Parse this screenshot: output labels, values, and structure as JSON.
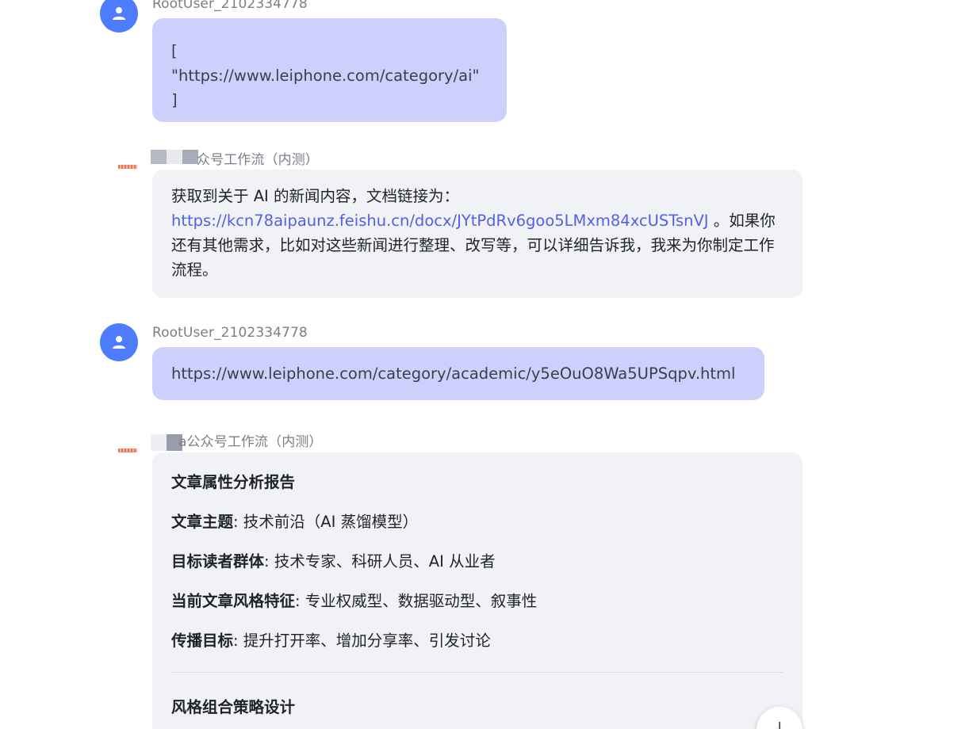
{
  "messages": [
    {
      "role": "user",
      "sender": "RootUser_2102334778",
      "lines": [
        "[",
        "\"https://www.leiphone.com/category/ai\"",
        "]"
      ]
    },
    {
      "role": "bot",
      "sender_visible": "众号工作流（内测）",
      "text_before_link": "获取到关于 AI 的新闻内容，文档链接为：",
      "link": "https://kcn78aipaunz.feishu.cn/docx/JYtPdRv6goo5LMxm84xcUSTsnVJ",
      "text_after_link_line1": " 。如果",
      "text_after_link_rest": "你还有其他需求，比如对这些新闻进行整理、改写等，可以详细告诉我，我来为你制定工作流程。"
    },
    {
      "role": "user",
      "sender": "RootUser_2102334778",
      "text": "https://www.leiphone.com/category/academic/y5eOuO8Wa5UPSqpv.html"
    },
    {
      "role": "bot",
      "sender_visible": "a公众号工作流（内测）",
      "report": {
        "title": "文章属性分析报告",
        "rows": [
          {
            "key": "文章主题",
            "value": ": 技术前沿（AI 蒸馏模型）"
          },
          {
            "key": "目标读者群体",
            "value": ": 技术专家、科研人员、AI 从业者"
          },
          {
            "key": "当前文章风格特征",
            "value": ": 专业权威型、数据驱动型、叙事性"
          },
          {
            "key": "传播目标",
            "value": ": 提升打开率、增加分享率、引发讨论"
          }
        ],
        "section2_title": "风格组合策略设计"
      }
    }
  ],
  "icons": {
    "user_avatar": "user-icon",
    "scroll_button": "arrow-down-icon"
  },
  "colors": {
    "avatar_bg": "#4d7cfe",
    "user_bubble": "#cdd0fd",
    "bot_bubble": "#f1f2f5",
    "link": "#4f62e5"
  },
  "scroll_button_glyph": "↓"
}
